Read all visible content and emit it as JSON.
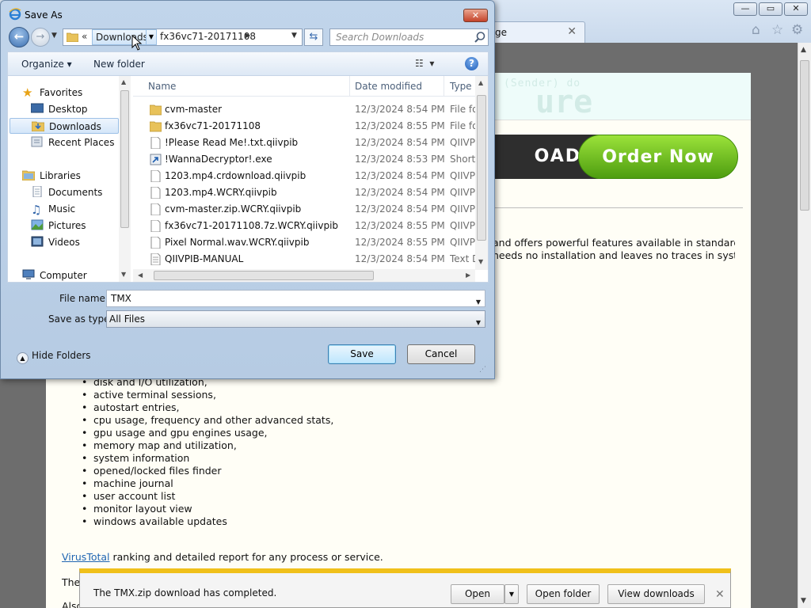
{
  "browser": {
    "tab_title": "ge",
    "window_controls": {
      "minimize": "—",
      "maximize": "▭",
      "close": "✕"
    },
    "toolbar_icons": [
      "home-icon",
      "star-icon",
      "gear-icon"
    ],
    "page": {
      "watermark_line1": "(Sender) do",
      "watermark_line2": "ure",
      "download_button": "OAD",
      "order_button": "Order Now",
      "para_line1": "and offers powerful features available in standard",
      "para_line2": "needs no installation and leaves no traces in system",
      "features": [
        "disk and I/O utilization,",
        "active terminal sessions,",
        "autostart entries,",
        "cpu usage, frequency and other advanced stats,",
        "gpu usage and gpu engines usage,",
        "memory map and utilization,",
        "system information",
        "opened/locked files finder",
        "machine journal",
        "user account list",
        "monitor layout view",
        "windows available updates"
      ],
      "virustotal_link": "VirusTotal",
      "virustotal_text": " ranking and detailed report for any process or service.",
      "fragment1": "The",
      "fragment2": "Also"
    }
  },
  "download_bar": {
    "message": "The TMX.zip download has completed.",
    "open_label": "Open",
    "open_folder_label": "Open folder",
    "view_downloads_label": "View downloads",
    "close_glyph": "✕"
  },
  "dialog": {
    "title": "Save As",
    "close_glyph": "✕",
    "address": {
      "overflow": "«",
      "crumbs": [
        "Downloads",
        "fx36vc71-20171108"
      ]
    },
    "search_placeholder": "Search Downloads",
    "toolbar": {
      "organize": "Organize ▾",
      "new_folder": "New folder",
      "help": "?"
    },
    "nav": {
      "favorites": "Favorites",
      "favorites_items": [
        "Desktop",
        "Downloads",
        "Recent Places"
      ],
      "selected": "Downloads",
      "libraries": "Libraries",
      "libraries_items": [
        "Documents",
        "Music",
        "Pictures",
        "Videos"
      ],
      "computer": "Computer"
    },
    "columns": {
      "name": "Name",
      "date": "Date modified",
      "type": "Type"
    },
    "files": [
      {
        "name": "cvm-master",
        "date": "12/3/2024 8:54 PM",
        "type": "File folder",
        "icon": "folder-icon"
      },
      {
        "name": "fx36vc71-20171108",
        "date": "12/3/2024 8:55 PM",
        "type": "File folder",
        "icon": "folder-icon"
      },
      {
        "name": "!Please Read Me!.txt.qiivpib",
        "date": "12/3/2024 8:54 PM",
        "type": "QIIVPIB File",
        "icon": "file-icon"
      },
      {
        "name": "!WannaDecryptor!.exe",
        "date": "12/3/2024 8:53 PM",
        "type": "Shortcut",
        "icon": "shortcut-icon"
      },
      {
        "name": "1203.mp4.crdownload.qiivpib",
        "date": "12/3/2024 8:54 PM",
        "type": "QIIVPIB File",
        "icon": "file-icon"
      },
      {
        "name": "1203.mp4.WCRY.qiivpib",
        "date": "12/3/2024 8:54 PM",
        "type": "QIIVPIB File",
        "icon": "file-icon"
      },
      {
        "name": "cvm-master.zip.WCRY.qiivpib",
        "date": "12/3/2024 8:54 PM",
        "type": "QIIVPIB File",
        "icon": "file-icon"
      },
      {
        "name": "fx36vc71-20171108.7z.WCRY.qiivpib",
        "date": "12/3/2024 8:55 PM",
        "type": "QIIVPIB File",
        "icon": "file-icon"
      },
      {
        "name": "Pixel Normal.wav.WCRY.qiivpib",
        "date": "12/3/2024 8:55 PM",
        "type": "QIIVPIB File",
        "icon": "file-icon"
      },
      {
        "name": "QIIVPIB-MANUAL",
        "date": "12/3/2024 8:54 PM",
        "type": "Text Document",
        "icon": "text-doc-icon"
      }
    ],
    "file_name_label": "File name:",
    "file_name_value": "TMX",
    "save_type_label": "Save as type:",
    "save_type_value": "All Files",
    "hide_folders": "Hide Folders",
    "save_label": "Save",
    "cancel_label": "Cancel"
  }
}
